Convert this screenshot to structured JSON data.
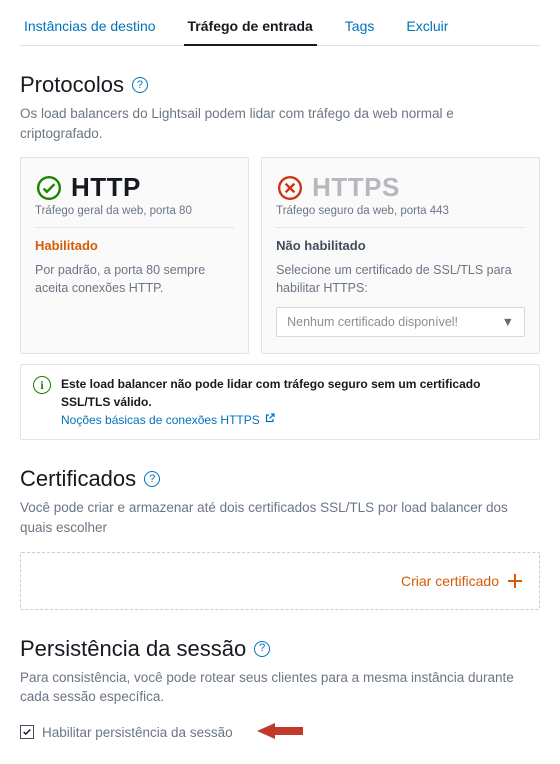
{
  "tabs": {
    "t0": "Instâncias de destino",
    "t1": "Tráfego de entrada",
    "t2": "Tags",
    "t3": "Excluir"
  },
  "protocols": {
    "title": "Protocolos",
    "desc": "Os load balancers do Lightsail podem lidar com tráfego da web normal e criptografado."
  },
  "http": {
    "name": "HTTP",
    "sub": "Tráfego geral da web, porta 80",
    "status": "Habilitado",
    "body": "Por padrão, a porta 80 sempre aceita conexões HTTP."
  },
  "https": {
    "name": "HTTPS",
    "sub": "Tráfego seguro da web, porta 443",
    "status": "Não habilitado",
    "body": "Selecione um certificado de SSL/TLS para habilitar HTTPS:",
    "select": "Nenhum certificado disponível!"
  },
  "info": {
    "strong": "Este load balancer não pode lidar com tráfego seguro sem um certificado SSL/TLS válido.",
    "link": "Noções básicas de conexões HTTPS"
  },
  "certs": {
    "title": "Certificados",
    "desc": "Você pode criar e armazenar até dois certificados SSL/TLS por load balancer dos quais escolher",
    "create": "Criar certificado"
  },
  "session": {
    "title": "Persistência da sessão",
    "desc": "Para consistência, você pode rotear seus clientes para a mesma instância durante cada sessão específica.",
    "checkbox": "Habilitar persistência da sessão"
  }
}
